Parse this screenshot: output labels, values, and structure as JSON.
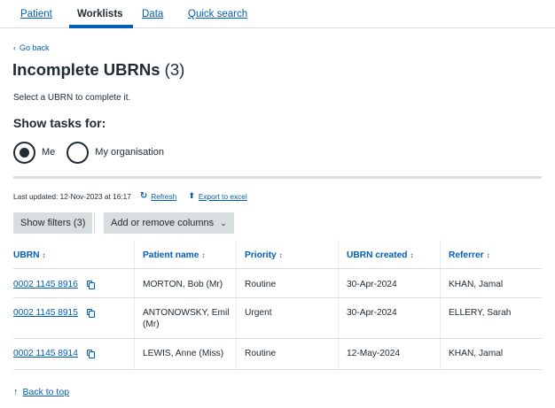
{
  "nav": {
    "tabs": [
      {
        "label": "Patient",
        "active": false
      },
      {
        "label": "Worklists",
        "active": true
      },
      {
        "label": "Data",
        "active": false
      },
      {
        "label": "Quick search",
        "active": false
      }
    ]
  },
  "back_link": {
    "icon": "chevron-left-icon",
    "label": "Go back"
  },
  "page": {
    "title": "Incomplete UBRNs",
    "count": "(3)",
    "subtitle": "Select a UBRN to complete it."
  },
  "show_tasks": {
    "label": "Show tasks for:",
    "options": [
      {
        "label": "Me",
        "selected": true
      },
      {
        "label": "My organisation",
        "selected": false
      }
    ]
  },
  "meta": {
    "last_updated": "Last updated: 12-Nov-2023 at 16:17",
    "refresh_label": "Refresh",
    "refresh_icon": "refresh-icon",
    "export_label": "Export to excel",
    "export_icon": "upload-icon"
  },
  "toolbar": {
    "show_filters": "Show filters (3)",
    "columns_label": "Add or remove columns",
    "columns_icon": "chevron-down-icon"
  },
  "table": {
    "sort_icon": "sort-icon",
    "columns": [
      "UBRN",
      "Patient name",
      "Priority",
      "UBRN created",
      "Referrer"
    ],
    "rows": [
      {
        "ubrn": "0002 1145 8916",
        "patient_name": "MORTON, Bob (Mr)",
        "priority": "Routine",
        "created": "30-Apr-2024",
        "referrer": "KHAN, Jamal"
      },
      {
        "ubrn": "0002 1145 8915",
        "patient_name": "ANTONOWSKY, Emil (Mr)",
        "priority": "Urgent",
        "created": "30-Apr-2024",
        "referrer": "ELLERY, Sarah"
      },
      {
        "ubrn": "0002 1145 8914",
        "patient_name": "LEWIS, Anne (Miss)",
        "priority": "Routine",
        "created": "12-May-2024",
        "referrer": "KHAN, Jamal"
      }
    ]
  },
  "footer": {
    "back_to_top": "Back to top",
    "icon": "arrow-up-icon"
  },
  "colors": {
    "link": "#005eb8",
    "text": "#212b32",
    "border": "#d8dde0"
  }
}
